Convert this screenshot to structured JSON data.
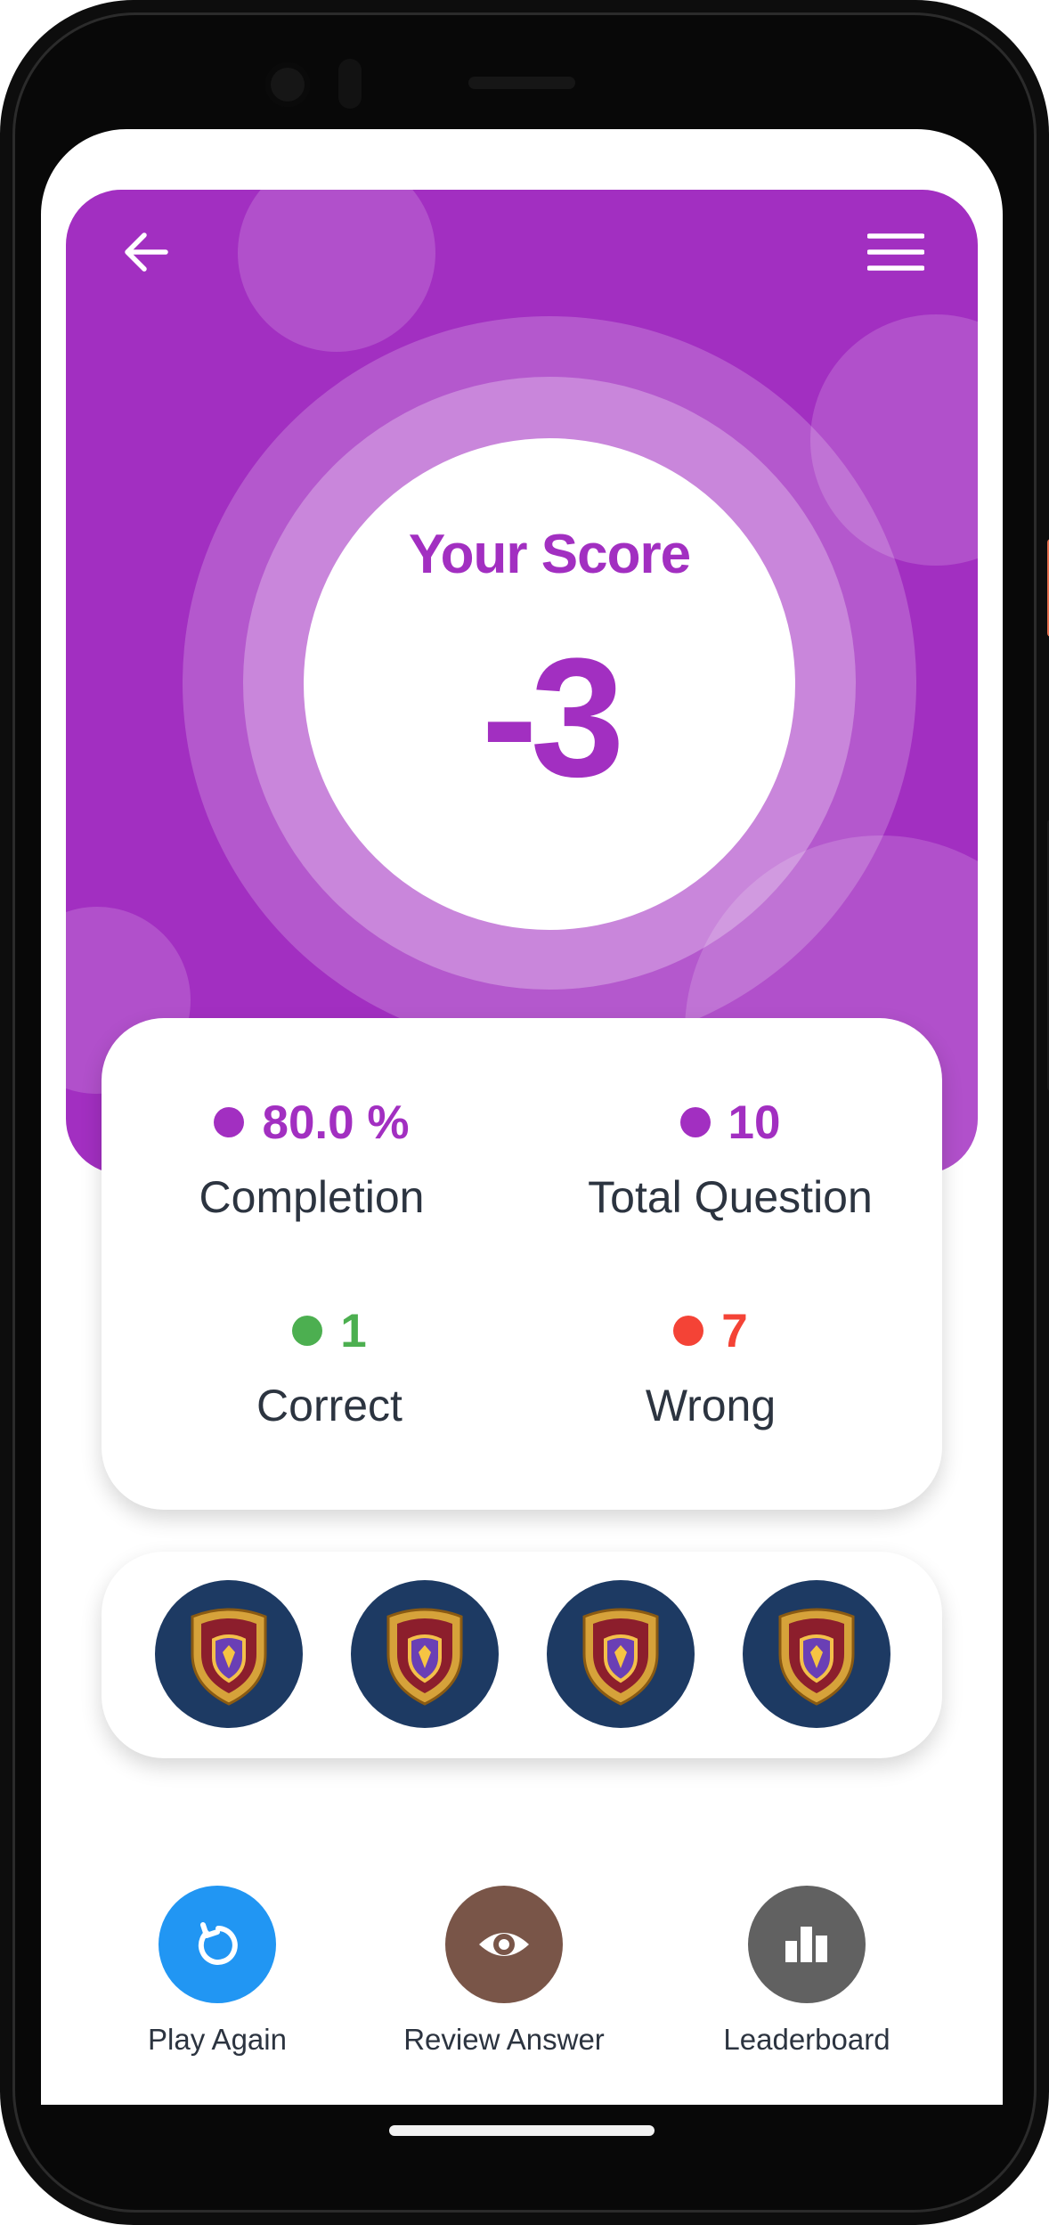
{
  "header": {
    "background": "#a22fc1",
    "back_icon": "arrow-left-icon",
    "menu_icon": "hamburger-menu-icon"
  },
  "score": {
    "label": "Your Score",
    "value": "-3"
  },
  "stats": {
    "completion": {
      "value": "80.0 %",
      "label": "Completion",
      "color": "#a22fc1"
    },
    "total": {
      "value": "10",
      "label": "Total Question",
      "color": "#a22fc1"
    },
    "correct": {
      "value": "1",
      "label": "Correct",
      "color": "#4caf50"
    },
    "wrong": {
      "value": "7",
      "label": "Wrong",
      "color": "#f44336"
    }
  },
  "badges": [
    "shield-badge-icon",
    "shield-badge-icon",
    "shield-badge-icon",
    "shield-badge-icon"
  ],
  "actions": {
    "play_again": {
      "label": "Play Again",
      "icon": "replay-icon",
      "color": "#2196f3"
    },
    "review_answer": {
      "label": "Review Answer",
      "icon": "eye-icon",
      "color": "#795548"
    },
    "leaderboard": {
      "label": "Leaderboard",
      "icon": "bar-chart-icon",
      "color": "#616161"
    }
  }
}
